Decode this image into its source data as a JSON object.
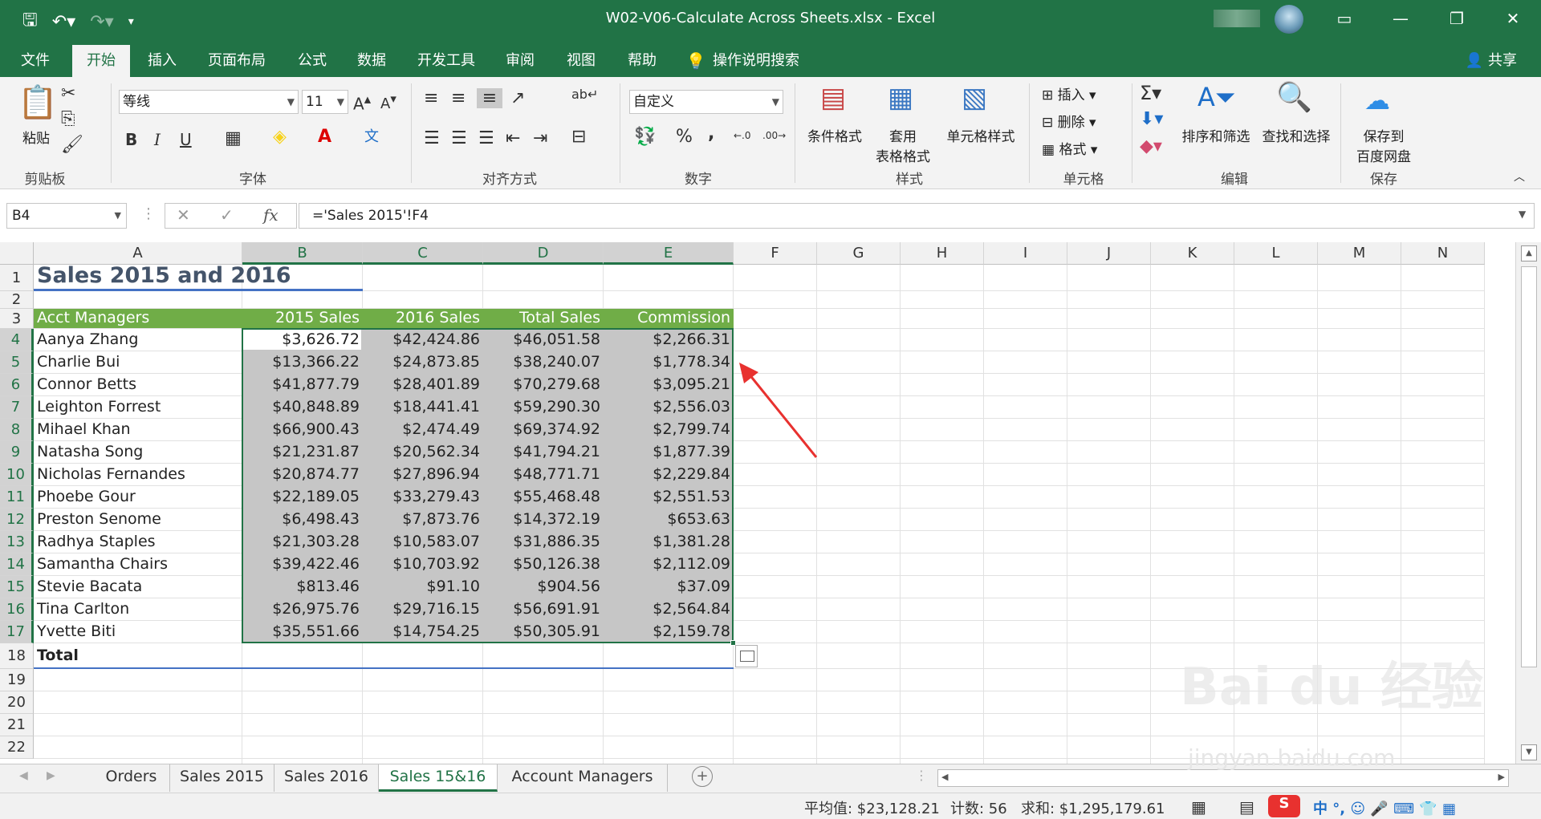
{
  "window": {
    "title": "W02-V06-Calculate Across Sheets.xlsx  -  Excel"
  },
  "ribbon_tabs": [
    "文件",
    "开始",
    "插入",
    "页面布局",
    "公式",
    "数据",
    "开发工具",
    "审阅",
    "视图",
    "帮助",
    "操作说明搜索"
  ],
  "share_label": "共享",
  "ribbon": {
    "clipboard_label": "剪贴板",
    "paste_label": "粘贴",
    "font_label": "字体",
    "font_name": "等线",
    "font_size": "11",
    "bold": "B",
    "italic": "I",
    "underline": "U",
    "align_label": "对齐方式",
    "number_label": "数字",
    "number_format": "自定义",
    "percent": "%",
    "comma": ",",
    "styles_label": "样式",
    "cond_format": "条件格式",
    "table_format_1": "套用",
    "table_format_2": "表格格式",
    "cell_styles": "单元格样式",
    "cells_label": "单元格",
    "insert": "插入",
    "delete": "删除",
    "format": "格式",
    "edit_label": "编辑",
    "sort_filter": "排序和筛选",
    "find_select": "查找和选择",
    "save_group_label": "保存",
    "save_baidu_1": "保存到",
    "save_baidu_2": "百度网盘"
  },
  "formula_bar": {
    "name_box": "B4",
    "formula": "='Sales 2015'!F4"
  },
  "columns": [
    "A",
    "B",
    "C",
    "D",
    "E",
    "F",
    "G",
    "H",
    "I",
    "J",
    "K",
    "L",
    "M",
    "N"
  ],
  "rows": [
    "1",
    "2",
    "3",
    "4",
    "5",
    "6",
    "7",
    "8",
    "9",
    "10",
    "11",
    "12",
    "13",
    "14",
    "15",
    "16",
    "17",
    "18",
    "19",
    "20",
    "21",
    "22"
  ],
  "sheet": {
    "title": "Sales 2015 and 2016",
    "headers": [
      "Acct Managers",
      "2015 Sales",
      "2016 Sales",
      "Total Sales",
      "Commission"
    ],
    "data": [
      [
        "Aanya Zhang",
        "$3,626.72",
        "$42,424.86",
        "$46,051.58",
        "$2,266.31"
      ],
      [
        "Charlie Bui",
        "$13,366.22",
        "$24,873.85",
        "$38,240.07",
        "$1,778.34"
      ],
      [
        "Connor Betts",
        "$41,877.79",
        "$28,401.89",
        "$70,279.68",
        "$3,095.21"
      ],
      [
        "Leighton Forrest",
        "$40,848.89",
        "$18,441.41",
        "$59,290.30",
        "$2,556.03"
      ],
      [
        "Mihael Khan",
        "$66,900.43",
        "$2,474.49",
        "$69,374.92",
        "$2,799.74"
      ],
      [
        "Natasha Song",
        "$21,231.87",
        "$20,562.34",
        "$41,794.21",
        "$1,877.39"
      ],
      [
        "Nicholas Fernandes",
        "$20,874.77",
        "$27,896.94",
        "$48,771.71",
        "$2,229.84"
      ],
      [
        "Phoebe Gour",
        "$22,189.05",
        "$33,279.43",
        "$55,468.48",
        "$2,551.53"
      ],
      [
        "Preston Senome",
        "$6,498.43",
        "$7,873.76",
        "$14,372.19",
        "$653.63"
      ],
      [
        "Radhya Staples",
        "$21,303.28",
        "$10,583.07",
        "$31,886.35",
        "$1,381.28"
      ],
      [
        "Samantha Chairs",
        "$39,422.46",
        "$10,703.92",
        "$50,126.38",
        "$2,112.09"
      ],
      [
        "Stevie Bacata",
        "$813.46",
        "$91.10",
        "$904.56",
        "$37.09"
      ],
      [
        "Tina Carlton",
        "$26,975.76",
        "$29,716.15",
        "$56,691.91",
        "$2,564.84"
      ],
      [
        "Yvette Biti",
        "$35,551.66",
        "$14,754.25",
        "$50,305.91",
        "$2,159.78"
      ]
    ],
    "total_label": "Total"
  },
  "sheet_tabs": [
    "Orders",
    "Sales 2015",
    "Sales 2016",
    "Sales 15&16",
    "Account Managers"
  ],
  "active_sheet_index": 3,
  "status": {
    "average": "平均值: $23,128.21",
    "count": "计数: 56",
    "sum": "求和: $1,295,179.61"
  },
  "watermark": {
    "text": "Bai du 经验",
    "url": "jingyan.baidu.com"
  },
  "colors": {
    "excel_green": "#217346",
    "header_green": "#70ad47",
    "title_blue": "#44546a",
    "arrow_red": "#e8312f"
  }
}
